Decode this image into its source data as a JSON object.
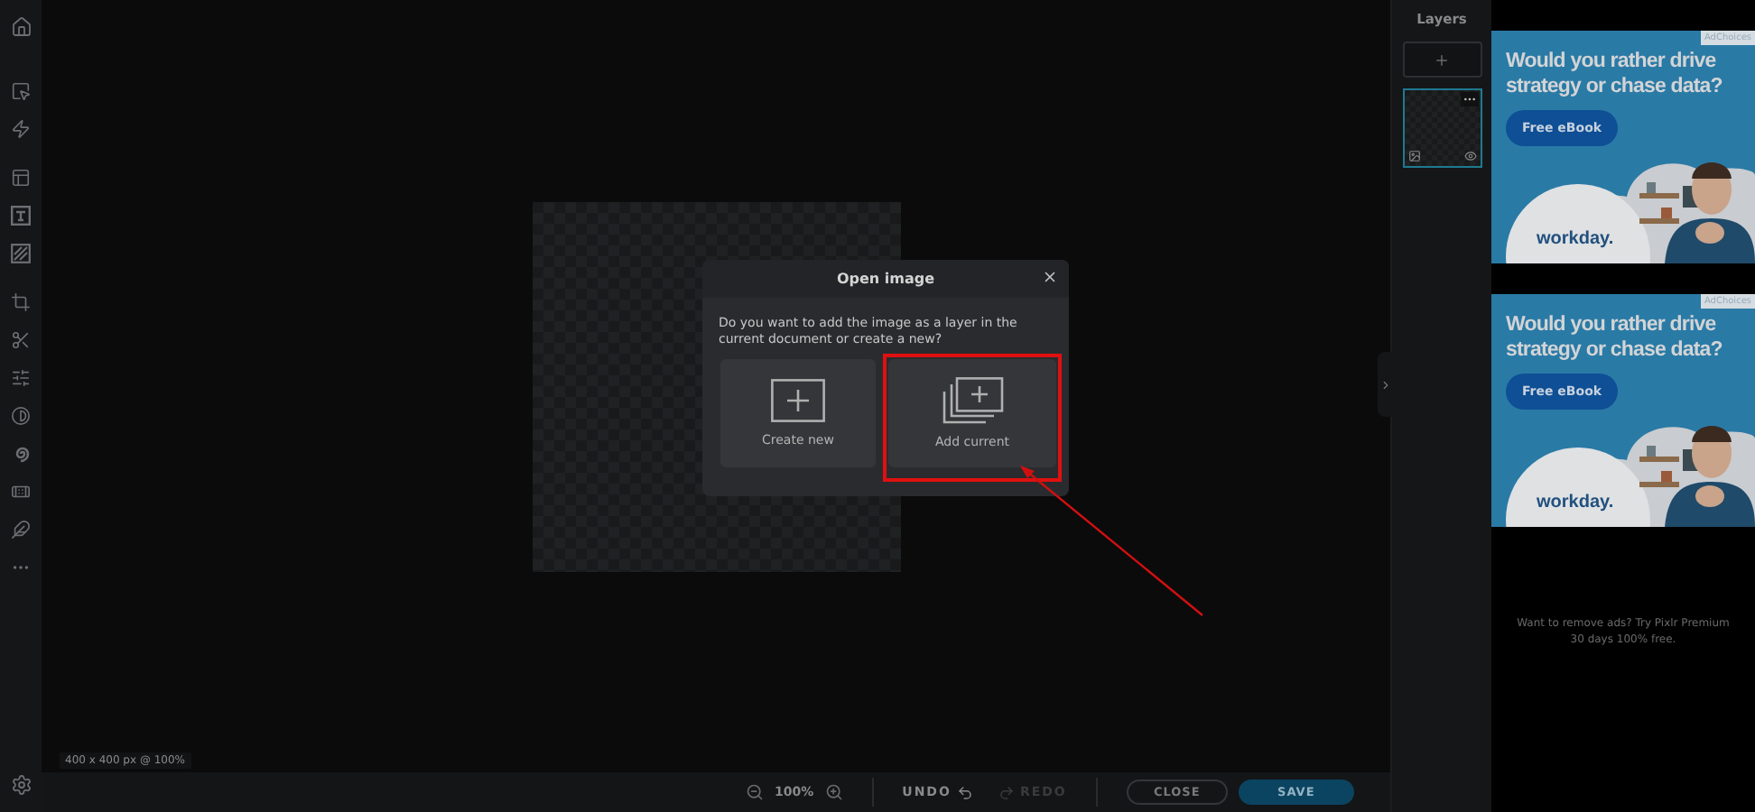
{
  "canvas": {
    "info": "400 x 400 px @ 100%"
  },
  "dialog": {
    "title": "Open image",
    "message": "Do you want to add the image as a layer in the current document or create a new?",
    "options": [
      {
        "kind": "new",
        "label": "Create new",
        "highlighted": false
      },
      {
        "kind": "add",
        "label": "Add current",
        "highlighted": true
      }
    ]
  },
  "layers": {
    "title": "Layers",
    "items": [
      {
        "selected": true
      }
    ]
  },
  "bottom_bar": {
    "zoom": "100%",
    "undo": {
      "label": "UNDO",
      "disabled": false
    },
    "redo": {
      "label": "REDO",
      "disabled": true
    },
    "close": "CLOSE",
    "save": "SAVE"
  },
  "ads": [
    {
      "badge": "AdChoices",
      "headline": "Would you rather drive strategy or chase data?",
      "button": "Free eBook",
      "logo": "workday."
    },
    {
      "badge": "AdChoices",
      "headline": "Would you rather drive strategy or chase data?",
      "button": "Free eBook",
      "logo": "workday."
    }
  ],
  "ad_note": {
    "lines": [
      "Want to remove ads? Try Pixlr Premium",
      "30 days 100% free."
    ]
  }
}
